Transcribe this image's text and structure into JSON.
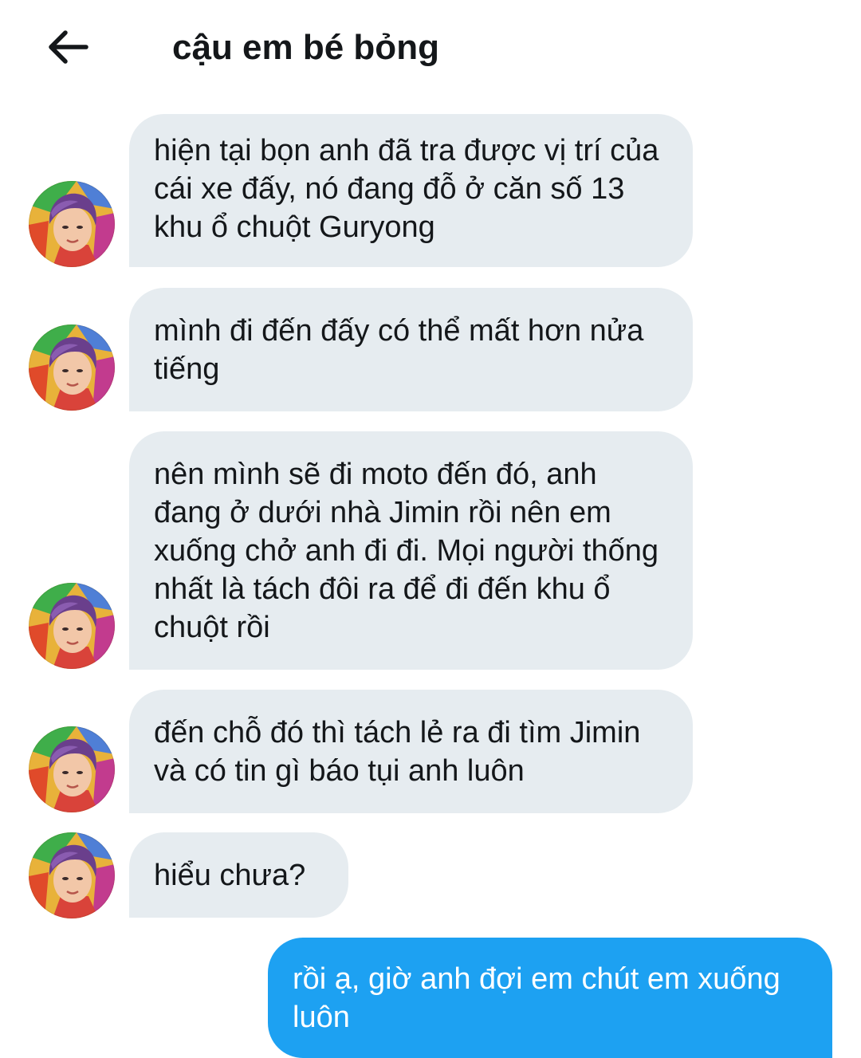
{
  "header": {
    "title": "cậu em bé bỏng",
    "back_icon": "arrow-left-icon"
  },
  "colors": {
    "incoming_bubble": "#e6ecf0",
    "outgoing_bubble": "#1da1f2",
    "text": "#14171a"
  },
  "messages": [
    {
      "sender": "contact",
      "text": "hiện tại bọn anh đã tra được vị trí của cái xe đấy, nó đang đỗ ở căn số 13 khu ổ chuột Guryong"
    },
    {
      "sender": "contact",
      "text": "mình đi đến đấy có thể mất hơn nửa tiếng"
    },
    {
      "sender": "contact",
      "text": "nên mình sẽ đi moto đến đó, anh đang ở dưới nhà Jimin rồi nên em xuống chở anh đi đi. Mọi người thống nhất là tách đôi ra để đi đến khu ổ chuột rồi"
    },
    {
      "sender": "contact",
      "text": "đến chỗ đó thì tách lẻ ra đi tìm Jimin và có tin gì báo tụi anh luôn"
    },
    {
      "sender": "contact",
      "text": "hiểu chưa?"
    },
    {
      "sender": "me",
      "text": "rồi ạ, giờ anh đợi em chút em xuống luôn"
    }
  ]
}
